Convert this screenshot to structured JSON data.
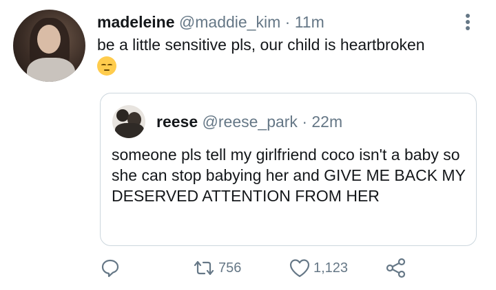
{
  "tweet": {
    "author_name": "madeleine",
    "author_handle": "@maddie_kim",
    "separator": "·",
    "time": "11m",
    "text": "be a little sensitive pls, our child is heartbroken",
    "emoji": "pensive-face-emoji"
  },
  "quoted_tweet": {
    "author_name": "reese",
    "author_handle": "@reese_park",
    "separator": "·",
    "time": "22m",
    "text": "someone pls tell my girlfriend coco isn't a baby so she can stop babying her and GIVE ME BACK MY DESERVED ATTENTION FROM HER"
  },
  "actions": {
    "reply_icon": "reply-icon",
    "retweet_icon": "retweet-icon",
    "retweet_count": "756",
    "like_icon": "heart-icon",
    "like_count": "1,123",
    "share_icon": "share-icon"
  },
  "colors": {
    "text": "#14171a",
    "secondary": "#657786",
    "border": "#ccd6dd"
  }
}
